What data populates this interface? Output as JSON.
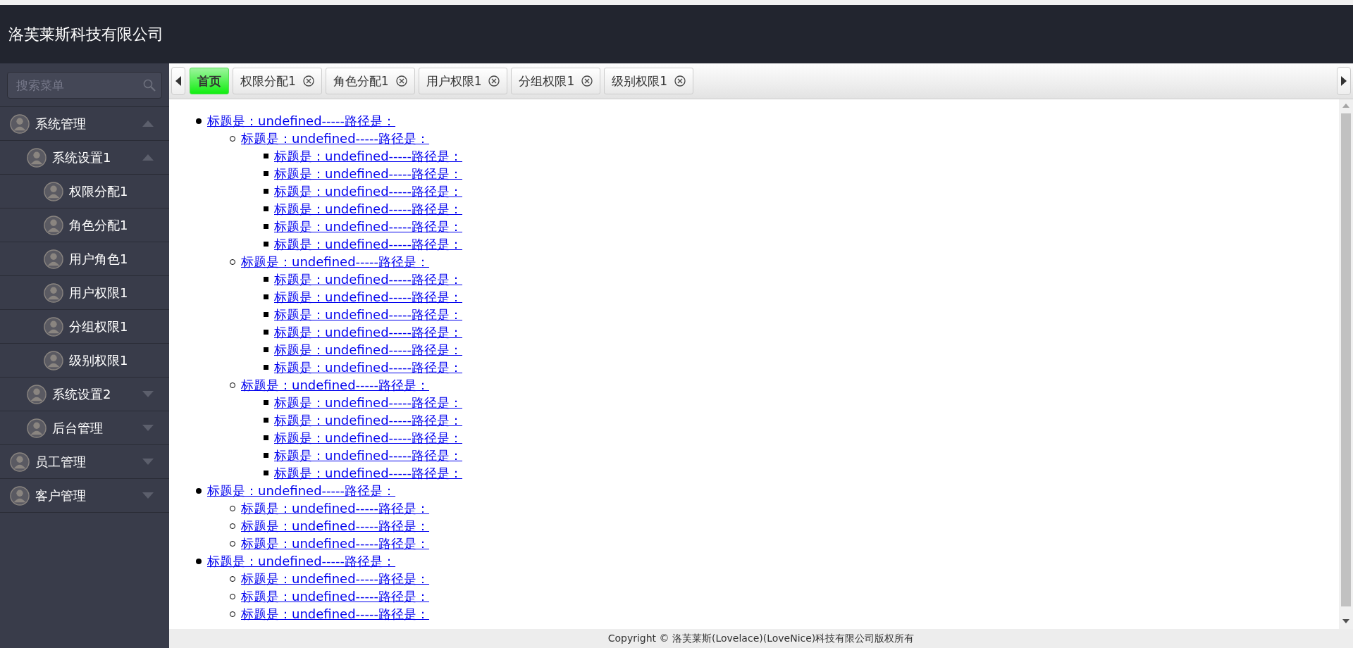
{
  "header": {
    "title": "洛芙莱斯科技有限公司"
  },
  "sidebar": {
    "search": {
      "placeholder": "搜索菜单"
    },
    "items": [
      {
        "label": "系统管理",
        "expanded": true,
        "children": [
          {
            "label": "系统设置1",
            "expanded": true,
            "children": [
              {
                "label": "权限分配1"
              },
              {
                "label": "角色分配1"
              },
              {
                "label": "用户角色1"
              },
              {
                "label": "用户权限1"
              },
              {
                "label": "分组权限1"
              },
              {
                "label": "级别权限1"
              }
            ]
          },
          {
            "label": "系统设置2",
            "expanded": false
          },
          {
            "label": "后台管理",
            "expanded": false
          }
        ]
      },
      {
        "label": "员工管理",
        "expanded": false
      },
      {
        "label": "客户管理",
        "expanded": false
      }
    ]
  },
  "tabs": [
    {
      "label": "首页",
      "selected": true,
      "closable": false
    },
    {
      "label": "权限分配1",
      "selected": false,
      "closable": true
    },
    {
      "label": "角色分配1",
      "selected": false,
      "closable": true
    },
    {
      "label": "用户权限1",
      "selected": false,
      "closable": true
    },
    {
      "label": "分组权限1",
      "selected": false,
      "closable": true
    },
    {
      "label": "级别权限1",
      "selected": false,
      "closable": true
    }
  ],
  "tree": [
    {
      "text": "标题是：undefined-----路径是：",
      "children": [
        {
          "text": "标题是：undefined-----路径是：",
          "children": [
            {
              "text": "标题是：undefined-----路径是："
            },
            {
              "text": "标题是：undefined-----路径是："
            },
            {
              "text": "标题是：undefined-----路径是："
            },
            {
              "text": "标题是：undefined-----路径是："
            },
            {
              "text": "标题是：undefined-----路径是："
            },
            {
              "text": "标题是：undefined-----路径是："
            }
          ]
        },
        {
          "text": "标题是：undefined-----路径是：",
          "children": [
            {
              "text": "标题是：undefined-----路径是："
            },
            {
              "text": "标题是：undefined-----路径是："
            },
            {
              "text": "标题是：undefined-----路径是："
            },
            {
              "text": "标题是：undefined-----路径是："
            },
            {
              "text": "标题是：undefined-----路径是："
            },
            {
              "text": "标题是：undefined-----路径是："
            }
          ]
        },
        {
          "text": "标题是：undefined-----路径是：",
          "children": [
            {
              "text": "标题是：undefined-----路径是："
            },
            {
              "text": "标题是：undefined-----路径是："
            },
            {
              "text": "标题是：undefined-----路径是："
            },
            {
              "text": "标题是：undefined-----路径是："
            },
            {
              "text": "标题是：undefined-----路径是："
            }
          ]
        }
      ]
    },
    {
      "text": "标题是：undefined-----路径是：",
      "children": [
        {
          "text": "标题是：undefined-----路径是："
        },
        {
          "text": "标题是：undefined-----路径是："
        },
        {
          "text": "标题是：undefined-----路径是："
        }
      ]
    },
    {
      "text": "标题是：undefined-----路径是：",
      "children": [
        {
          "text": "标题是：undefined-----路径是："
        },
        {
          "text": "标题是：undefined-----路径是："
        },
        {
          "text": "标题是：undefined-----路径是："
        }
      ]
    }
  ],
  "footer": {
    "text": "Copyright © 洛芙莱斯(Lovelace)(LoveNice)科技有限公司版权所有"
  }
}
